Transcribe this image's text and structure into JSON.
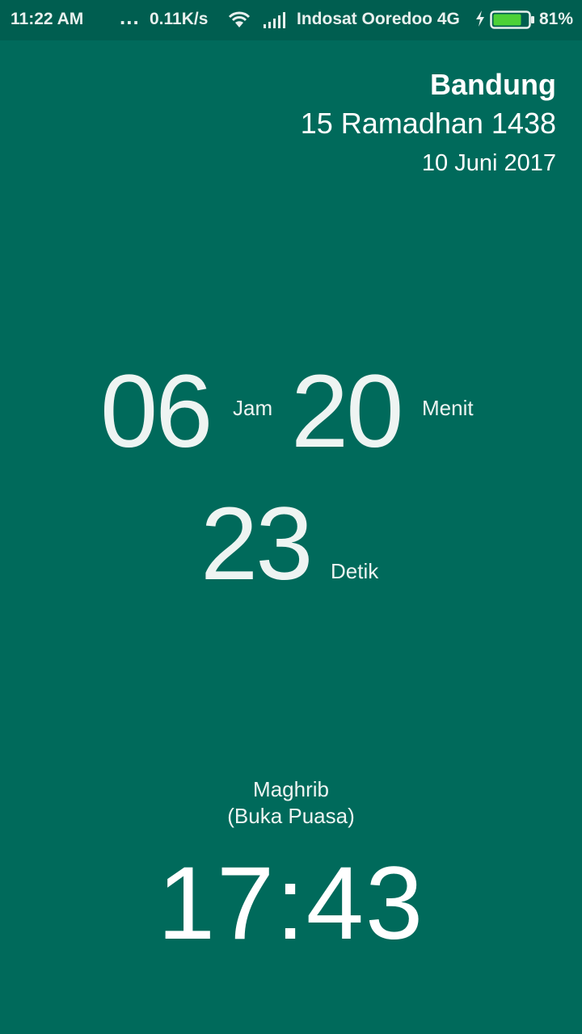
{
  "status_bar": {
    "time": "11:22 AM",
    "dots": "...",
    "network_speed": "0.11K/s",
    "carrier": "Indosat Ooredoo 4G",
    "battery_percent": "81%",
    "battery_level": 0.81,
    "icons": [
      "wifi-icon",
      "signal-icon",
      "charging-icon",
      "battery-icon"
    ]
  },
  "header": {
    "location": "Bandung",
    "hijri_date": "15 Ramadhan 1438",
    "gregorian_date": "10 Juni 2017"
  },
  "countdown": {
    "hours": "06",
    "hours_label": "Jam",
    "minutes": "20",
    "minutes_label": "Menit",
    "seconds": "23",
    "seconds_label": "Detik"
  },
  "next_prayer": {
    "name": "Maghrib",
    "subtitle": "(Buka Puasa)",
    "time": "17:43"
  },
  "colors": {
    "background": "#006A5B",
    "status_bar": "#005E50",
    "battery_fill": "#4CD137"
  }
}
